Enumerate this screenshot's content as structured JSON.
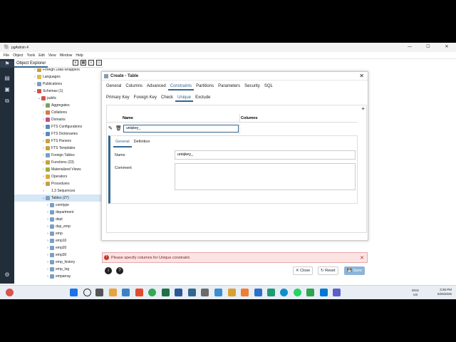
{
  "app": {
    "title": "pgAdmin 4",
    "controls": [
      "—",
      "☐",
      "✕"
    ]
  },
  "menu": [
    "File",
    "Object",
    "Tools",
    "Edit",
    "View",
    "Window",
    "Help"
  ],
  "explorer": {
    "tab": "Object Explorer",
    "items": [
      {
        "label": "Foreign Data Wrappers",
        "color": "#c8a040"
      },
      {
        "label": "Languages",
        "color": "#e2b84c"
      },
      {
        "label": "Publications",
        "color": "#7a9fc4"
      },
      {
        "label": "Schemas (1)",
        "color": "#d4504c"
      },
      {
        "label": "public",
        "color": "#d4504c"
      },
      {
        "label": "Aggregates",
        "color": "#7aa35a"
      },
      {
        "label": "Collations",
        "color": "#d47a4c"
      },
      {
        "label": "Domains",
        "color": "#c04c8c"
      },
      {
        "label": "FTS Configurations",
        "color": "#5a8ac4"
      },
      {
        "label": "FTS Dictionaries",
        "color": "#5a8ac4"
      },
      {
        "label": "FTS Parsers",
        "color": "#c8a040"
      },
      {
        "label": "FTS Templates",
        "color": "#c8a040"
      },
      {
        "label": "Foreign Tables",
        "color": "#7a9fc4"
      },
      {
        "label": "Functions (23)",
        "color": "#c8a040"
      },
      {
        "label": "Materialized Views",
        "color": "#9ab040"
      },
      {
        "label": "Operators",
        "color": "#e2a830"
      },
      {
        "label": "Procedures",
        "color": "#c8a040"
      },
      {
        "label": "1.3 Sequences",
        "color": "#ffffff"
      },
      {
        "label": "Tables (27)",
        "color": "#7a9fc4"
      },
      {
        "label": "comtype",
        "color": "#7a9fc4"
      },
      {
        "label": "department",
        "color": "#7a9fc4"
      },
      {
        "label": "dept",
        "color": "#7a9fc4"
      },
      {
        "label": "dup_emp",
        "color": "#7a9fc4"
      },
      {
        "label": "emp",
        "color": "#7a9fc4"
      },
      {
        "label": "emp10",
        "color": "#7a9fc4"
      },
      {
        "label": "emp20",
        "color": "#7a9fc4"
      },
      {
        "label": "emp30",
        "color": "#7a9fc4"
      },
      {
        "label": "emp_history",
        "color": "#7a9fc4"
      },
      {
        "label": "emp_log",
        "color": "#7a9fc4"
      },
      {
        "label": "emparray",
        "color": "#7a9fc4"
      }
    ]
  },
  "dialog": {
    "title": "Create - Table",
    "tabs": [
      "General",
      "Columns",
      "Advanced",
      "Constraints",
      "Partitions",
      "Parameters",
      "Security",
      "SQL"
    ],
    "active_tab": "Constraints",
    "constraint_tabs": [
      "Primary Key",
      "Foreign Key",
      "Check",
      "Unique",
      "Exclude"
    ],
    "active_constraint": "Unique",
    "grid": {
      "col_name": "Name",
      "col_columns": "Columns",
      "row_name": "uniqkey_"
    },
    "detail": {
      "tabs": [
        "General",
        "Definition"
      ],
      "name_label": "Name",
      "name_value": "uniqkey_",
      "comment_label": "Comment",
      "comment_value": ""
    },
    "error": "Please specify columns for Unique constraint.",
    "buttons": {
      "close": "Close",
      "reset": "Reset",
      "save": "Save"
    }
  },
  "tray": {
    "lang": "ENG",
    "region": "US",
    "time": "3:36 PM",
    "date": "6/25/2025"
  }
}
